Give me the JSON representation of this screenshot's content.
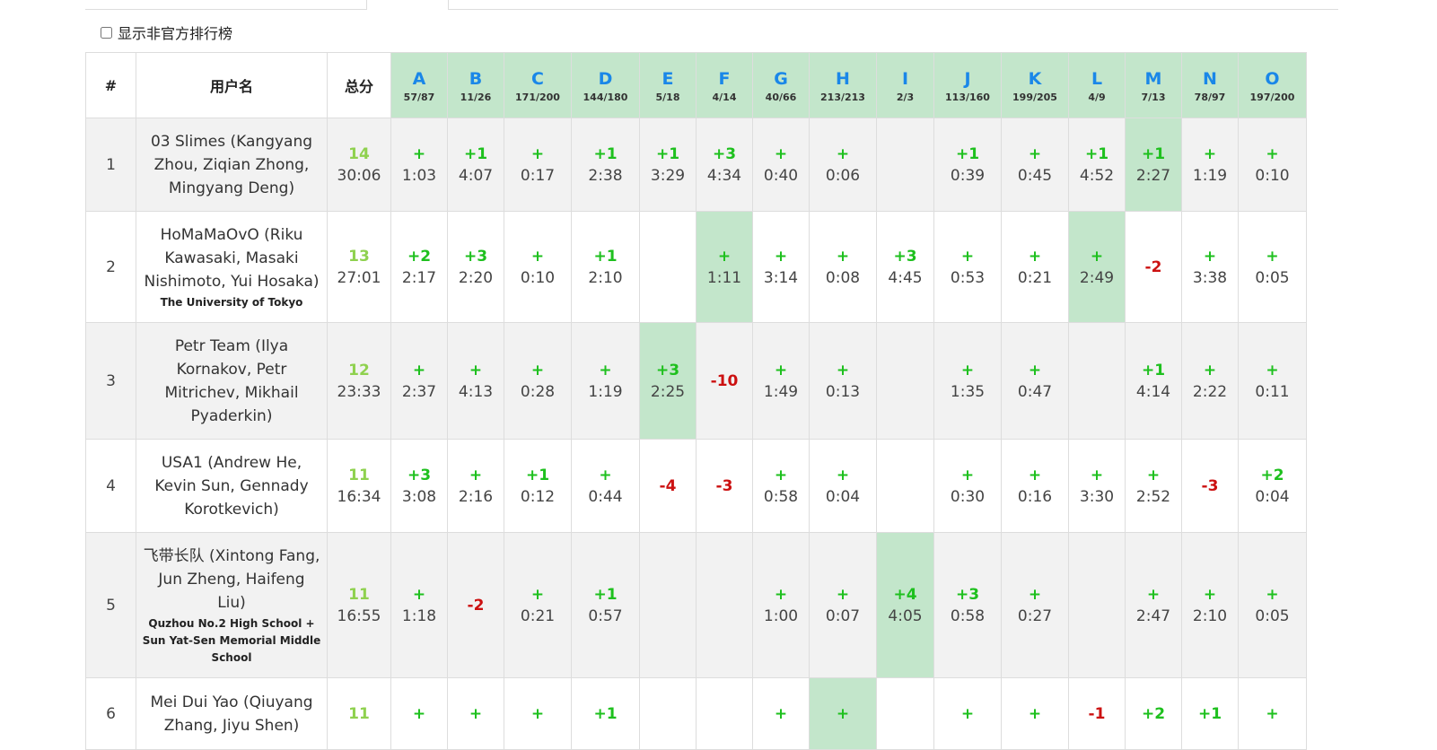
{
  "toggle": {
    "label": "显示非官方排行榜"
  },
  "colors": {
    "accepted": "#1ec01e",
    "rejected": "#cc1111",
    "first_solve_bg": "#c3e6cb",
    "problem_letter": "#1a87e8",
    "solved_count": "#8fd14f"
  },
  "header": {
    "rank": "#",
    "user": "用户名",
    "total": "总分",
    "problems": [
      {
        "letter": "A",
        "stat": "57/87"
      },
      {
        "letter": "B",
        "stat": "11/26"
      },
      {
        "letter": "C",
        "stat": "171/200"
      },
      {
        "letter": "D",
        "stat": "144/180"
      },
      {
        "letter": "E",
        "stat": "5/18"
      },
      {
        "letter": "F",
        "stat": "4/14"
      },
      {
        "letter": "G",
        "stat": "40/66"
      },
      {
        "letter": "H",
        "stat": "213/213"
      },
      {
        "letter": "I",
        "stat": "2/3"
      },
      {
        "letter": "J",
        "stat": "113/160"
      },
      {
        "letter": "K",
        "stat": "199/205"
      },
      {
        "letter": "L",
        "stat": "4/9"
      },
      {
        "letter": "M",
        "stat": "7/13"
      },
      {
        "letter": "N",
        "stat": "78/97"
      },
      {
        "letter": "O",
        "stat": "197/200"
      }
    ]
  },
  "rows": [
    {
      "rank": "1",
      "team": "03 Slimes (Kangyang Zhou, Ziqian Zhong, Mingyang Deng)",
      "school": "",
      "solved": "14",
      "penalty": "30:06",
      "cells": [
        {
          "t": "+",
          "time": "1:03"
        },
        {
          "t": "+1",
          "time": "4:07"
        },
        {
          "t": "+",
          "time": "0:17"
        },
        {
          "t": "+1",
          "time": "2:38"
        },
        {
          "t": "+1",
          "time": "3:29"
        },
        {
          "t": "+3",
          "time": "4:34"
        },
        {
          "t": "+",
          "time": "0:40"
        },
        {
          "t": "+",
          "time": "0:06"
        },
        {
          "t": "",
          "time": ""
        },
        {
          "t": "+1",
          "time": "0:39"
        },
        {
          "t": "+",
          "time": "0:45"
        },
        {
          "t": "+1",
          "time": "4:52"
        },
        {
          "t": "+1",
          "time": "2:27",
          "first": true
        },
        {
          "t": "+",
          "time": "1:19"
        },
        {
          "t": "+",
          "time": "0:10"
        }
      ]
    },
    {
      "rank": "2",
      "team": "HoMaMaOvO (Riku Kawasaki, Masaki Nishimoto, Yui Hosaka)",
      "school": "The University of Tokyo",
      "solved": "13",
      "penalty": "27:01",
      "cells": [
        {
          "t": "+2",
          "time": "2:17"
        },
        {
          "t": "+3",
          "time": "2:20"
        },
        {
          "t": "+",
          "time": "0:10"
        },
        {
          "t": "+1",
          "time": "2:10"
        },
        {
          "t": "",
          "time": ""
        },
        {
          "t": "+",
          "time": "1:11",
          "first": true
        },
        {
          "t": "+",
          "time": "3:14"
        },
        {
          "t": "+",
          "time": "0:08"
        },
        {
          "t": "+3",
          "time": "4:45"
        },
        {
          "t": "+",
          "time": "0:53"
        },
        {
          "t": "+",
          "time": "0:21"
        },
        {
          "t": "+",
          "time": "2:49",
          "first": true
        },
        {
          "t": "-2",
          "time": ""
        },
        {
          "t": "+",
          "time": "3:38"
        },
        {
          "t": "+",
          "time": "0:05"
        }
      ]
    },
    {
      "rank": "3",
      "team": "Petr Team (Ilya Kornakov, Petr Mitrichev, Mikhail Pyaderkin)",
      "school": "",
      "solved": "12",
      "penalty": "23:33",
      "cells": [
        {
          "t": "+",
          "time": "2:37"
        },
        {
          "t": "+",
          "time": "4:13"
        },
        {
          "t": "+",
          "time": "0:28"
        },
        {
          "t": "+",
          "time": "1:19"
        },
        {
          "t": "+3",
          "time": "2:25",
          "first": true
        },
        {
          "t": "-10",
          "time": ""
        },
        {
          "t": "+",
          "time": "1:49"
        },
        {
          "t": "+",
          "time": "0:13"
        },
        {
          "t": "",
          "time": ""
        },
        {
          "t": "+",
          "time": "1:35"
        },
        {
          "t": "+",
          "time": "0:47"
        },
        {
          "t": "",
          "time": ""
        },
        {
          "t": "+1",
          "time": "4:14"
        },
        {
          "t": "+",
          "time": "2:22"
        },
        {
          "t": "+",
          "time": "0:11"
        }
      ]
    },
    {
      "rank": "4",
      "team": "USA1 (Andrew He, Kevin Sun, Gennady Korotkevich)",
      "school": "",
      "solved": "11",
      "penalty": "16:34",
      "cells": [
        {
          "t": "+3",
          "time": "3:08"
        },
        {
          "t": "+",
          "time": "2:16"
        },
        {
          "t": "+1",
          "time": "0:12"
        },
        {
          "t": "+",
          "time": "0:44"
        },
        {
          "t": "-4",
          "time": ""
        },
        {
          "t": "-3",
          "time": ""
        },
        {
          "t": "+",
          "time": "0:58"
        },
        {
          "t": "+",
          "time": "0:04"
        },
        {
          "t": "",
          "time": ""
        },
        {
          "t": "+",
          "time": "0:30"
        },
        {
          "t": "+",
          "time": "0:16"
        },
        {
          "t": "+",
          "time": "3:30"
        },
        {
          "t": "+",
          "time": "2:52"
        },
        {
          "t": "-3",
          "time": ""
        },
        {
          "t": "+2",
          "time": "0:04"
        }
      ]
    },
    {
      "rank": "5",
      "team": "飞带长队 (Xintong Fang, Jun Zheng, Haifeng Liu)",
      "school": "Quzhou No.2 High School + Sun Yat-Sen Memorial Middle School",
      "solved": "11",
      "penalty": "16:55",
      "cells": [
        {
          "t": "+",
          "time": "1:18"
        },
        {
          "t": "-2",
          "time": ""
        },
        {
          "t": "+",
          "time": "0:21"
        },
        {
          "t": "+1",
          "time": "0:57"
        },
        {
          "t": "",
          "time": ""
        },
        {
          "t": "",
          "time": ""
        },
        {
          "t": "+",
          "time": "1:00"
        },
        {
          "t": "+",
          "time": "0:07"
        },
        {
          "t": "+4",
          "time": "4:05",
          "first": true
        },
        {
          "t": "+3",
          "time": "0:58"
        },
        {
          "t": "+",
          "time": "0:27"
        },
        {
          "t": "",
          "time": ""
        },
        {
          "t": "+",
          "time": "2:47"
        },
        {
          "t": "+",
          "time": "2:10"
        },
        {
          "t": "+",
          "time": "0:05"
        }
      ]
    },
    {
      "rank": "6",
      "team": "Mei Dui Yao (Qiuyang Zhang, Jiyu Shen)",
      "school": "",
      "solved": "11",
      "penalty": "",
      "cells": [
        {
          "t": "+",
          "time": ""
        },
        {
          "t": "+",
          "time": ""
        },
        {
          "t": "+",
          "time": ""
        },
        {
          "t": "+1",
          "time": ""
        },
        {
          "t": "",
          "time": ""
        },
        {
          "t": "",
          "time": ""
        },
        {
          "t": "+",
          "time": ""
        },
        {
          "t": "+",
          "time": "",
          "first": true
        },
        {
          "t": "",
          "time": ""
        },
        {
          "t": "+",
          "time": ""
        },
        {
          "t": "+",
          "time": ""
        },
        {
          "t": "-1",
          "time": ""
        },
        {
          "t": "+2",
          "time": ""
        },
        {
          "t": "+1",
          "time": ""
        },
        {
          "t": "+",
          "time": ""
        }
      ]
    }
  ]
}
